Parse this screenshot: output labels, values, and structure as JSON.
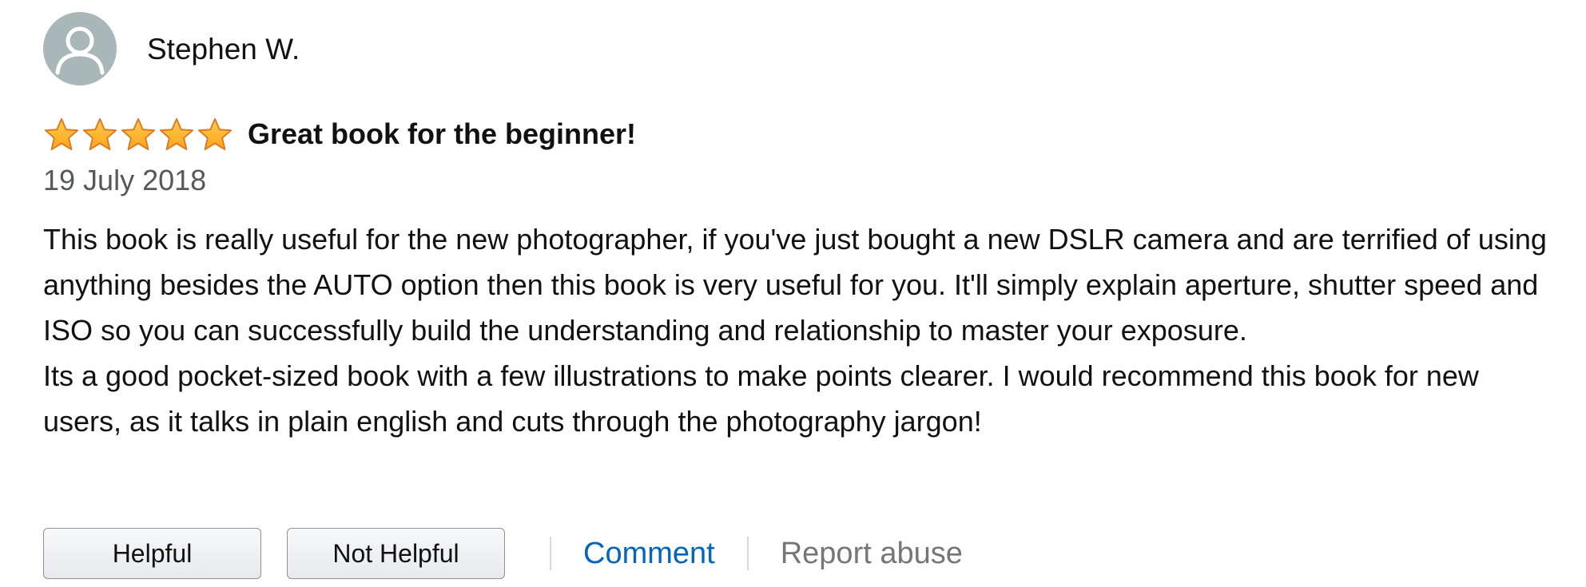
{
  "review": {
    "author_name": "Stephen W.",
    "rating": 5,
    "rating_max": 5,
    "title": "Great book for the beginner!",
    "date": "19 July 2018",
    "body_paragraphs": [
      "This book is really useful for the new photographer, if you've just bought a new DSLR camera and are terrified of using anything besides the AUTO option then this book is very useful for you. It'll simply explain aperture, shutter speed and ISO so you can successfully build the understanding and relationship to master your exposure.",
      "Its a good pocket-sized book with a few illustrations to make points clearer. I would recommend this book for new users, as it talks in plain english and cuts through the photography jargon!"
    ]
  },
  "actions": {
    "helpful_label": "Helpful",
    "not_helpful_label": "Not Helpful",
    "comment_label": "Comment",
    "report_label": "Report abuse"
  },
  "colors": {
    "star_fill": "#ffa41c",
    "star_stroke": "#de7921",
    "link": "#0066c0",
    "muted": "#565959",
    "avatar_bg": "#aab7b8"
  },
  "icons": {
    "avatar": "user-silhouette-icon",
    "star": "star-filled-icon"
  }
}
